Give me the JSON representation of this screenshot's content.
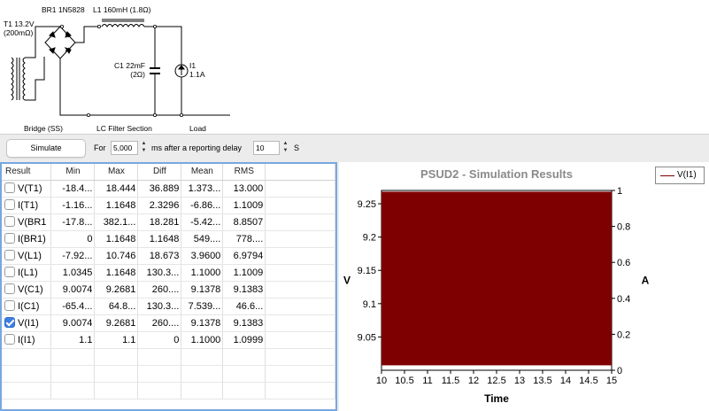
{
  "schematic": {
    "transformer_label": "T1 13.2V\n(200mΩ)",
    "bridge_part_label": "BR1 1N5828",
    "inductor_label": "L1 160mH (1.8Ω)",
    "capacitor_label": "C1 22mF\n(2Ω)",
    "load_label": "I1\n1.1A",
    "section_bridge": "Bridge (SS)",
    "section_filter": "LC Filter Section",
    "section_load": "Load"
  },
  "toolbar": {
    "simulate_label": "Simulate",
    "for_label": "For",
    "duration_value": "5,000",
    "after_label": "ms after a reporting delay",
    "delay_value": "10",
    "unit_label": "S"
  },
  "table": {
    "headers": [
      "Result",
      "Min",
      "Max",
      "Diff",
      "Mean",
      "RMS"
    ],
    "rows": [
      {
        "name": "V(T1)",
        "checked": false,
        "min": "-18.4...",
        "max": "18.444",
        "diff": "36.889",
        "mean": "1.373...",
        "rms": "13.000"
      },
      {
        "name": "I(T1)",
        "checked": false,
        "min": "-1.16...",
        "max": "1.1648",
        "diff": "2.3296",
        "mean": "-6.86...",
        "rms": "1.1009"
      },
      {
        "name": "V(BR1",
        "checked": false,
        "min": "-17.8...",
        "max": "382.1...",
        "diff": "18.281",
        "mean": "-5.42...",
        "rms": "8.8507"
      },
      {
        "name": "I(BR1)",
        "checked": false,
        "min": "0",
        "max": "1.1648",
        "diff": "1.1648",
        "mean": "549....",
        "rms": "778...."
      },
      {
        "name": "V(L1)",
        "checked": false,
        "min": "-7.92...",
        "max": "10.746",
        "diff": "18.673",
        "mean": "3.9600",
        "rms": "6.9794"
      },
      {
        "name": "I(L1)",
        "checked": false,
        "min": "1.0345",
        "max": "1.1648",
        "diff": "130.3...",
        "mean": "1.1000",
        "rms": "1.1009"
      },
      {
        "name": "V(C1)",
        "checked": false,
        "min": "9.0074",
        "max": "9.2681",
        "diff": "260....",
        "mean": "9.1378",
        "rms": "9.1383"
      },
      {
        "name": "I(C1)",
        "checked": false,
        "min": "-65.4...",
        "max": "64.8...",
        "diff": "130.3...",
        "mean": "7.539...",
        "rms": "46.6..."
      },
      {
        "name": "V(I1)",
        "checked": true,
        "min": "9.0074",
        "max": "9.2681",
        "diff": "260....",
        "mean": "9.1378",
        "rms": "9.1383"
      },
      {
        "name": "I(I1)",
        "checked": false,
        "min": "1.1",
        "max": "1.1",
        "diff": "0",
        "mean": "1.1000",
        "rms": "1.0999"
      }
    ]
  },
  "chart_data": {
    "type": "area",
    "title": "PSUD2 - Simulation Results",
    "xlabel": "Time",
    "ylabel_left": "V",
    "ylabel_right": "A",
    "xlim": [
      10,
      15
    ],
    "ylim_left": [
      9.0,
      9.27
    ],
    "ylim_right": [
      0,
      1
    ],
    "x_ticks": [
      "10",
      "10.5",
      "11",
      "11.5",
      "12",
      "12.5",
      "13",
      "13.5",
      "14",
      "14.5",
      "15"
    ],
    "y_ticks_left": [
      "9.05",
      "9.1",
      "9.15",
      "9.2",
      "9.25"
    ],
    "y_ticks_right": [
      "0",
      "0.2",
      "0.4",
      "0.6",
      "0.8",
      "1"
    ],
    "series": [
      {
        "name": "V(I1)",
        "color": "#7f0000",
        "min": 9.0074,
        "max": 9.2681
      }
    ],
    "legend_position": "top-right"
  }
}
